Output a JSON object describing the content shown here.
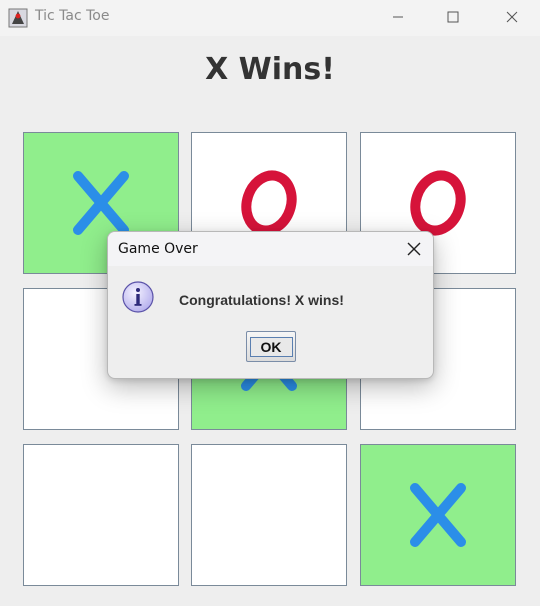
{
  "window": {
    "title": "Tic Tac Toe",
    "icon": "java-duke-icon"
  },
  "controls": {
    "minimize_icon": "minimize-icon",
    "maximize_icon": "maximize-icon",
    "close_icon": "close-icon"
  },
  "heading": "X Wins!",
  "board": {
    "cells": [
      {
        "mark": "X",
        "win": true
      },
      {
        "mark": "O",
        "win": false
      },
      {
        "mark": "O",
        "win": false
      },
      {
        "mark": "",
        "win": false
      },
      {
        "mark": "X",
        "win": true
      },
      {
        "mark": "",
        "win": false
      },
      {
        "mark": "",
        "win": false
      },
      {
        "mark": "",
        "win": false
      },
      {
        "mark": "X",
        "win": true
      }
    ],
    "colors": {
      "x": "#2b8ee8",
      "o": "#d6133a",
      "win_bg": "#90ee8c",
      "cell_bg": "#ffffff"
    }
  },
  "dialog": {
    "title": "Game Over",
    "message": "Congratulations! X wins!",
    "ok_label": "OK",
    "icon": "info-icon"
  }
}
